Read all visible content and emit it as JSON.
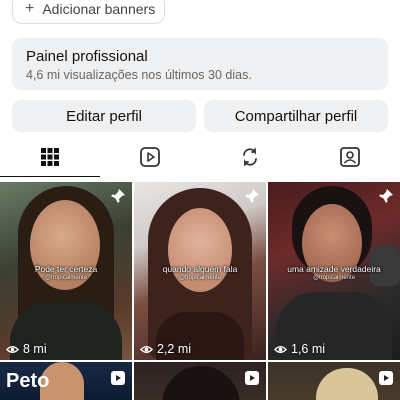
{
  "banners": {
    "plus_symbol": "+",
    "label": "Adicionar banners"
  },
  "dashboard": {
    "title": "Painel profissional",
    "subtitle": "4,6 mi visualizações nos últimos 30 dias."
  },
  "actions": {
    "edit_label": "Editar perfil",
    "share_label": "Compartilhar perfil"
  },
  "tabs": [
    {
      "icon": "grid-icon",
      "active": true
    },
    {
      "icon": "reels-icon",
      "active": false
    },
    {
      "icon": "repost-icon",
      "active": false
    },
    {
      "icon": "tagged-icon",
      "active": false
    }
  ],
  "posts": [
    {
      "caption": "Pode ter certeza",
      "handle": "@tropicalmente",
      "views": "8 mi",
      "pinned": true
    },
    {
      "caption": "quando alguém fala",
      "handle": "@tropicalmente",
      "views": "2,2 mi",
      "pinned": true
    },
    {
      "caption": "uma amizade verdadeira",
      "handle": "@tropicalmente",
      "views": "1,6 mi",
      "pinned": true
    },
    {
      "overlay_text": "Peto",
      "reel": true
    },
    {
      "reel": true
    },
    {
      "reel": true
    }
  ]
}
